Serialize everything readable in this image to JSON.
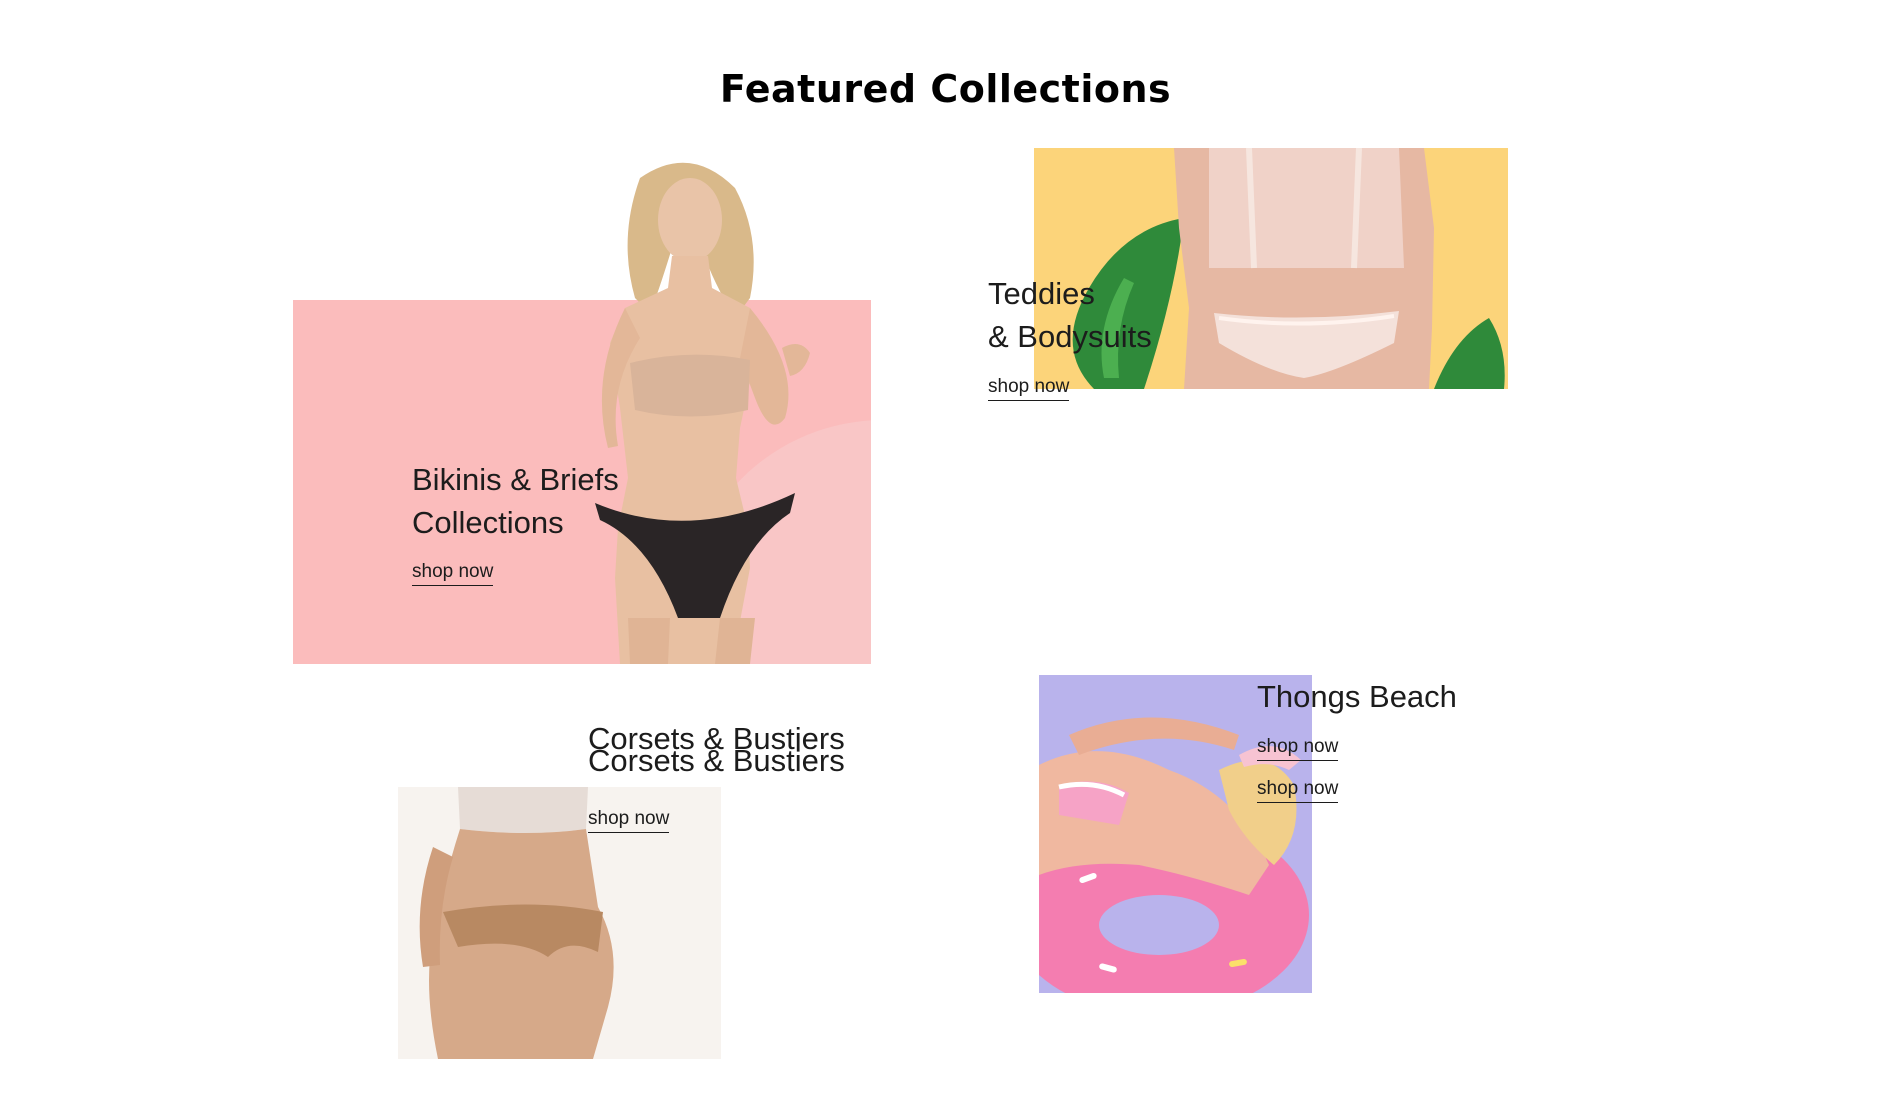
{
  "section": {
    "title": "Featured Collections"
  },
  "collections": [
    {
      "title_line1": "Bikinis & Briefs",
      "title_line2": "Collections",
      "cta": "shop now",
      "bg_color": "#fbbcbc"
    },
    {
      "title_line1": "Teddies",
      "title_line2": "& Bodysuits",
      "cta": "shop now",
      "bg_color": "#fcd47a"
    },
    {
      "title_line1": "Corsets & Bustiers",
      "title_line2": "Corsets & Bustiers",
      "cta": "shop now",
      "bg_color": "#f7f3ef"
    },
    {
      "title_line1": "Thongs Beach",
      "cta": "shop now",
      "cta_2": "shop now",
      "bg_color": "#b9b3ec"
    }
  ]
}
